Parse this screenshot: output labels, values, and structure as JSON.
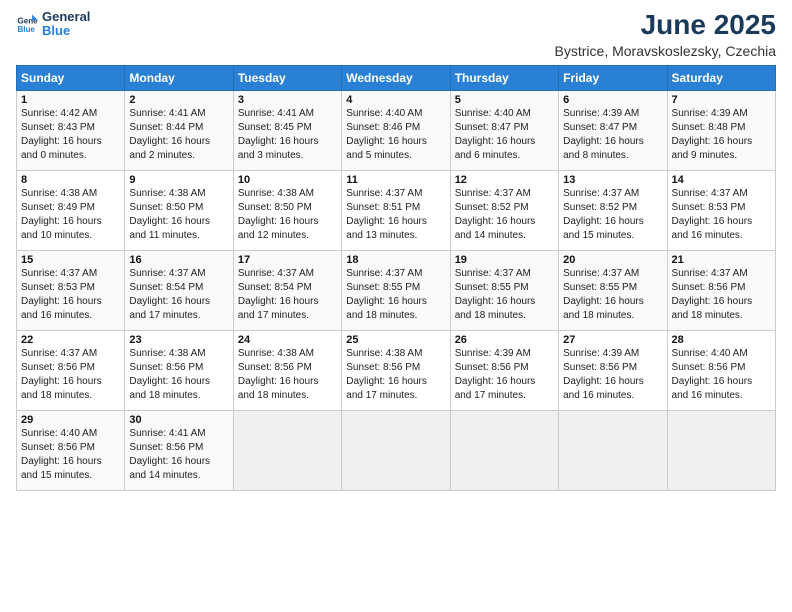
{
  "header": {
    "logo_line1": "General",
    "logo_line2": "Blue",
    "title": "June 2025",
    "subtitle": "Bystrice, Moravskoslezsky, Czechia"
  },
  "days_of_week": [
    "Sunday",
    "Monday",
    "Tuesday",
    "Wednesday",
    "Thursday",
    "Friday",
    "Saturday"
  ],
  "weeks": [
    [
      {
        "day": "1",
        "sunrise": "4:42 AM",
        "sunset": "8:43 PM",
        "daylight": "16 hours and 0 minutes."
      },
      {
        "day": "2",
        "sunrise": "4:41 AM",
        "sunset": "8:44 PM",
        "daylight": "16 hours and 2 minutes."
      },
      {
        "day": "3",
        "sunrise": "4:41 AM",
        "sunset": "8:45 PM",
        "daylight": "16 hours and 3 minutes."
      },
      {
        "day": "4",
        "sunrise": "4:40 AM",
        "sunset": "8:46 PM",
        "daylight": "16 hours and 5 minutes."
      },
      {
        "day": "5",
        "sunrise": "4:40 AM",
        "sunset": "8:47 PM",
        "daylight": "16 hours and 6 minutes."
      },
      {
        "day": "6",
        "sunrise": "4:39 AM",
        "sunset": "8:47 PM",
        "daylight": "16 hours and 8 minutes."
      },
      {
        "day": "7",
        "sunrise": "4:39 AM",
        "sunset": "8:48 PM",
        "daylight": "16 hours and 9 minutes."
      }
    ],
    [
      {
        "day": "8",
        "sunrise": "4:38 AM",
        "sunset": "8:49 PM",
        "daylight": "16 hours and 10 minutes."
      },
      {
        "day": "9",
        "sunrise": "4:38 AM",
        "sunset": "8:50 PM",
        "daylight": "16 hours and 11 minutes."
      },
      {
        "day": "10",
        "sunrise": "4:38 AM",
        "sunset": "8:50 PM",
        "daylight": "16 hours and 12 minutes."
      },
      {
        "day": "11",
        "sunrise": "4:37 AM",
        "sunset": "8:51 PM",
        "daylight": "16 hours and 13 minutes."
      },
      {
        "day": "12",
        "sunrise": "4:37 AM",
        "sunset": "8:52 PM",
        "daylight": "16 hours and 14 minutes."
      },
      {
        "day": "13",
        "sunrise": "4:37 AM",
        "sunset": "8:52 PM",
        "daylight": "16 hours and 15 minutes."
      },
      {
        "day": "14",
        "sunrise": "4:37 AM",
        "sunset": "8:53 PM",
        "daylight": "16 hours and 16 minutes."
      }
    ],
    [
      {
        "day": "15",
        "sunrise": "4:37 AM",
        "sunset": "8:53 PM",
        "daylight": "16 hours and 16 minutes."
      },
      {
        "day": "16",
        "sunrise": "4:37 AM",
        "sunset": "8:54 PM",
        "daylight": "16 hours and 17 minutes."
      },
      {
        "day": "17",
        "sunrise": "4:37 AM",
        "sunset": "8:54 PM",
        "daylight": "16 hours and 17 minutes."
      },
      {
        "day": "18",
        "sunrise": "4:37 AM",
        "sunset": "8:55 PM",
        "daylight": "16 hours and 18 minutes."
      },
      {
        "day": "19",
        "sunrise": "4:37 AM",
        "sunset": "8:55 PM",
        "daylight": "16 hours and 18 minutes."
      },
      {
        "day": "20",
        "sunrise": "4:37 AM",
        "sunset": "8:55 PM",
        "daylight": "16 hours and 18 minutes."
      },
      {
        "day": "21",
        "sunrise": "4:37 AM",
        "sunset": "8:56 PM",
        "daylight": "16 hours and 18 minutes."
      }
    ],
    [
      {
        "day": "22",
        "sunrise": "4:37 AM",
        "sunset": "8:56 PM",
        "daylight": "16 hours and 18 minutes."
      },
      {
        "day": "23",
        "sunrise": "4:38 AM",
        "sunset": "8:56 PM",
        "daylight": "16 hours and 18 minutes."
      },
      {
        "day": "24",
        "sunrise": "4:38 AM",
        "sunset": "8:56 PM",
        "daylight": "16 hours and 18 minutes."
      },
      {
        "day": "25",
        "sunrise": "4:38 AM",
        "sunset": "8:56 PM",
        "daylight": "16 hours and 17 minutes."
      },
      {
        "day": "26",
        "sunrise": "4:39 AM",
        "sunset": "8:56 PM",
        "daylight": "16 hours and 17 minutes."
      },
      {
        "day": "27",
        "sunrise": "4:39 AM",
        "sunset": "8:56 PM",
        "daylight": "16 hours and 16 minutes."
      },
      {
        "day": "28",
        "sunrise": "4:40 AM",
        "sunset": "8:56 PM",
        "daylight": "16 hours and 16 minutes."
      }
    ],
    [
      {
        "day": "29",
        "sunrise": "4:40 AM",
        "sunset": "8:56 PM",
        "daylight": "16 hours and 15 minutes."
      },
      {
        "day": "30",
        "sunrise": "4:41 AM",
        "sunset": "8:56 PM",
        "daylight": "16 hours and 14 minutes."
      },
      {
        "day": "",
        "sunrise": "",
        "sunset": "",
        "daylight": ""
      },
      {
        "day": "",
        "sunrise": "",
        "sunset": "",
        "daylight": ""
      },
      {
        "day": "",
        "sunrise": "",
        "sunset": "",
        "daylight": ""
      },
      {
        "day": "",
        "sunrise": "",
        "sunset": "",
        "daylight": ""
      },
      {
        "day": "",
        "sunrise": "",
        "sunset": "",
        "daylight": ""
      }
    ]
  ]
}
